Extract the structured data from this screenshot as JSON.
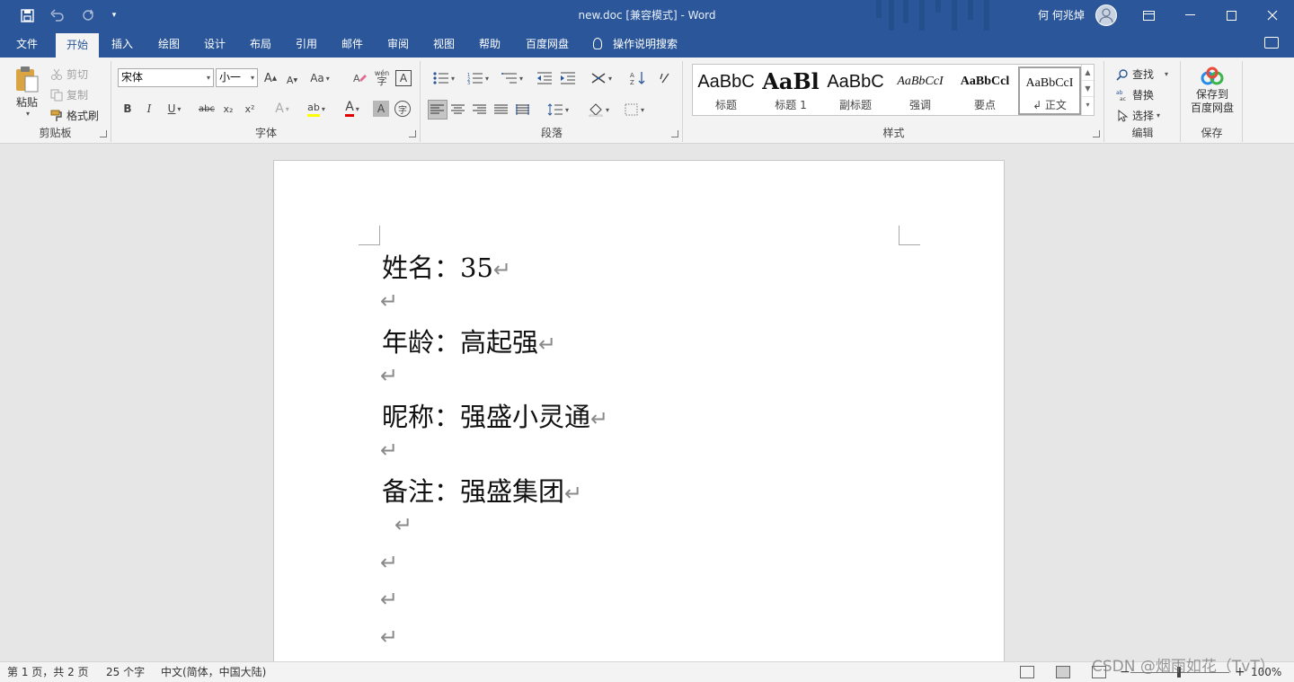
{
  "titlebar": {
    "doc_title": "new.doc [兼容模式]  -  Word",
    "user_name": "何 何兆焯",
    "save_icon": "save-icon",
    "undo_icon": "undo-icon",
    "redo_icon": "redo-icon",
    "customize_icon": "customize-quick-access-icon"
  },
  "tabs": [
    {
      "label": "文件"
    },
    {
      "label": "开始"
    },
    {
      "label": "插入"
    },
    {
      "label": "绘图"
    },
    {
      "label": "设计"
    },
    {
      "label": "布局"
    },
    {
      "label": "引用"
    },
    {
      "label": "邮件"
    },
    {
      "label": "审阅"
    },
    {
      "label": "视图"
    },
    {
      "label": "帮助"
    },
    {
      "label": "百度网盘"
    }
  ],
  "tell_me": "操作说明搜索",
  "clipboard": {
    "paste": "粘贴",
    "cut": "剪切",
    "copy": "复制",
    "format_painter": "格式刷",
    "label": "剪贴板"
  },
  "font": {
    "name": "宋体",
    "size": "小一",
    "change_case": "Aa",
    "phonetic": "wén",
    "label": "字体",
    "bold": "B",
    "italic": "I",
    "underline": "U",
    "strike": "abc",
    "subscript": "x₂",
    "superscript": "x²",
    "text_effects": "A",
    "highlight": "ab",
    "font_color": "A",
    "char_shading": "A",
    "enclose": "字",
    "border_a": "A",
    "grow": "A",
    "shrink": "A"
  },
  "paragraph": {
    "label": "段落"
  },
  "styles": {
    "label": "样式",
    "items": [
      {
        "sample": "AaBbC",
        "name": "标题"
      },
      {
        "sample": "AaBl",
        "name": "标题 1"
      },
      {
        "sample": "AaBbC",
        "name": "副标题"
      },
      {
        "sample": "AaBbCcI",
        "name": "强调"
      },
      {
        "sample": "AaBbCcl",
        "name": "要点"
      },
      {
        "sample": "AaBbCcI",
        "name": "↲ 正文"
      }
    ]
  },
  "editing": {
    "find": "查找",
    "replace": "替换",
    "select": "选择",
    "label": "编辑"
  },
  "save_group": {
    "button_line1": "保存到",
    "button_line2": "百度网盘",
    "label": "保存"
  },
  "document": {
    "lines": [
      "姓名：35",
      "年龄：高起强",
      "昵称：强盛小灵通",
      "备注：强盛集团"
    ],
    "para_mark": "↵"
  },
  "status": {
    "page": "第 1 页，共 2 页",
    "words": "25 个字",
    "language": "中文(简体，中国大陆)",
    "zoom": "100%",
    "watermark": "CSDN @烟雨如花（TvT）"
  },
  "colors": {
    "brand": "#2b579a",
    "ribbon_bg": "#f3f3f3",
    "canvas_bg": "#e6e6e6",
    "highlight_yellow": "#ffff00",
    "font_red": "#e00000"
  }
}
